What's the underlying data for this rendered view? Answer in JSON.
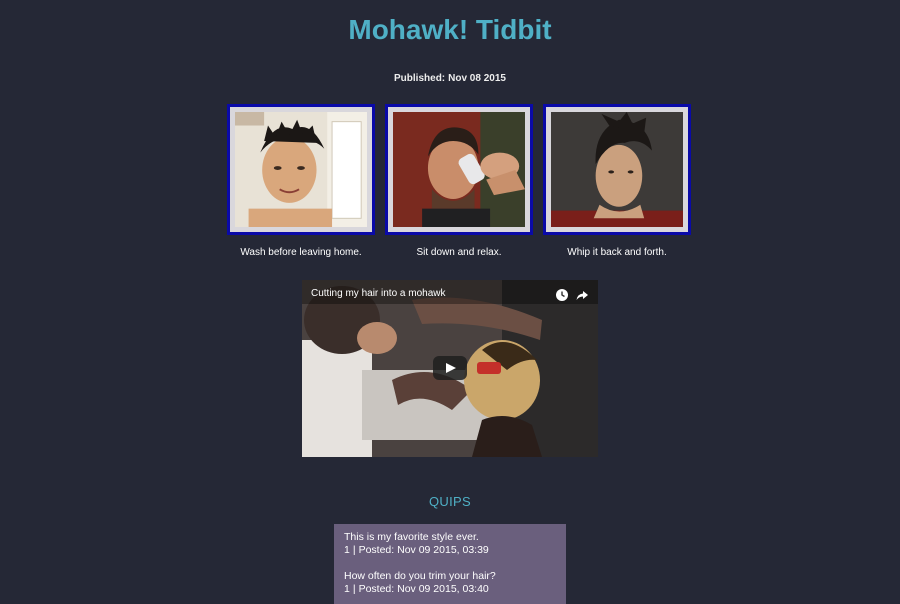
{
  "page": {
    "title": "Mohawk! Tidbit",
    "published_label": "Published:",
    "published_date": "Nov 08 2015"
  },
  "gallery": [
    {
      "caption": "Wash before leaving home."
    },
    {
      "caption": "Sit down and relax."
    },
    {
      "caption": "Whip it back and forth."
    }
  ],
  "video": {
    "title": "Cutting my hair into a mohawk",
    "icons": [
      "clock-icon",
      "share-icon",
      "play-icon"
    ]
  },
  "quips": {
    "heading": "QUIPS",
    "items": [
      {
        "text": "This is my favorite style ever.",
        "votes": "1",
        "separator": "|",
        "posted_label": "Posted:",
        "posted": "Nov 09 2015, 03:39"
      },
      {
        "text": "How often do you trim your hair?",
        "votes": "1",
        "separator": "|",
        "posted_label": "Posted:",
        "posted": "Nov 09 2015, 03:40"
      }
    ]
  },
  "colors": {
    "background": "#252836",
    "accent": "#4fb0c6",
    "thumb_border": "#0a0aa8",
    "quips_box": "#6a5f7d"
  }
}
